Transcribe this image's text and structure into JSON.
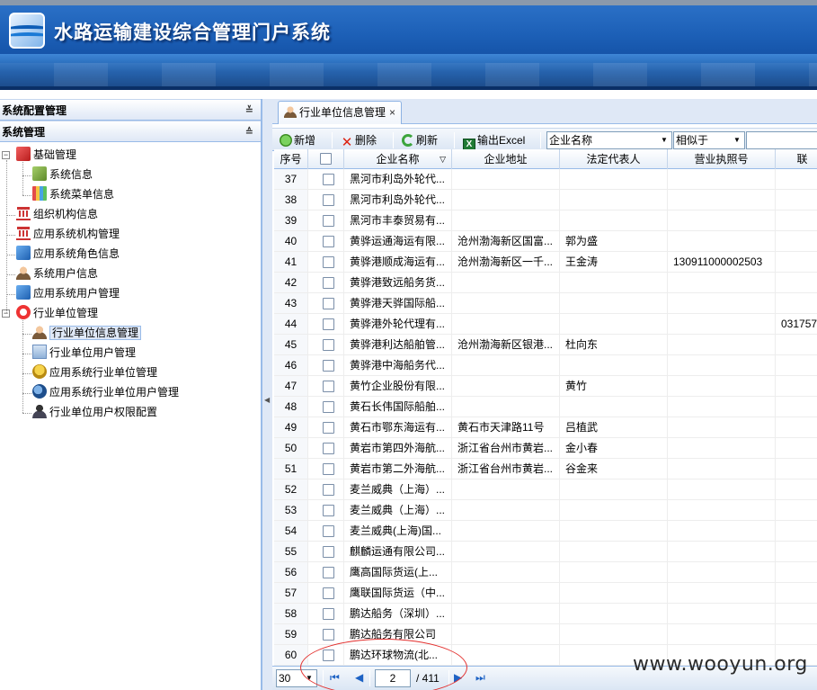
{
  "app": {
    "title": "水路运输建设综合管理门户系统"
  },
  "sidebar": {
    "panel1": {
      "title": "系统配置管理",
      "toggle": "≚"
    },
    "panel2": {
      "title": "系统管理",
      "toggle": "≙"
    },
    "tree": [
      {
        "label": "基础管理",
        "icon": "cube-icon",
        "level": 0,
        "expanded": true
      },
      {
        "label": "系统信息",
        "icon": "module-icon",
        "level": 1
      },
      {
        "label": "系统菜单信息",
        "icon": "menu-icon",
        "level": 1
      },
      {
        "label": "组织机构信息",
        "icon": "org-icon",
        "level": 0
      },
      {
        "label": "应用系统机构管理",
        "icon": "org-icon",
        "level": 0
      },
      {
        "label": "应用系统角色信息",
        "icon": "role-icon",
        "level": 0
      },
      {
        "label": "系统用户信息",
        "icon": "user-icon",
        "level": 0
      },
      {
        "label": "应用系统用户管理",
        "icon": "role-icon",
        "level": 0
      },
      {
        "label": "行业单位管理",
        "icon": "lifebuoy-icon",
        "level": 0,
        "expanded": true
      },
      {
        "label": "行业单位信息管理",
        "icon": "user-icon",
        "level": 1,
        "selected": true
      },
      {
        "label": "行业单位用户管理",
        "icon": "doc-icon",
        "level": 1
      },
      {
        "label": "应用系统行业单位管理",
        "icon": "gold-user-icon",
        "level": 1
      },
      {
        "label": "应用系统行业单位用户管理",
        "icon": "badge-icon",
        "level": 1
      },
      {
        "label": "行业单位用户权限配置",
        "icon": "person-icon",
        "level": 1
      }
    ]
  },
  "tabs": [
    {
      "label": "行业单位信息管理",
      "close": "×"
    }
  ],
  "toolbar": {
    "add": "新增",
    "delete": "删除",
    "refresh": "刷新",
    "export": "输出Excel",
    "field_select": "企业名称",
    "operator_select": "相似于",
    "search_value": ""
  },
  "grid": {
    "columns": [
      "序号",
      "",
      "企业名称",
      "企业地址",
      "法定代表人",
      "营业执照号",
      "联"
    ],
    "rows": [
      [
        "37",
        "黑河市利岛外轮代...",
        "",
        "",
        ""
      ],
      [
        "38",
        "黑河市利岛外轮代...",
        "",
        "",
        ""
      ],
      [
        "39",
        "黑河市丰泰贸易有...",
        "",
        "",
        ""
      ],
      [
        "40",
        "黄骅运通海运有限...",
        "沧州渤海新区国富...",
        "郭为盛",
        ""
      ],
      [
        "41",
        "黄骅港顺成海运有...",
        "沧州渤海新区一千...",
        "王金涛",
        "130911000002503"
      ],
      [
        "42",
        "黄骅港致远船务货...",
        "",
        "",
        ""
      ],
      [
        "43",
        "黄骅港天骅国际船...",
        "",
        "",
        ""
      ],
      [
        "44",
        "黄骅港外轮代理有...",
        "",
        "",
        "",
        "031757"
      ],
      [
        "45",
        "黄骅港利达船舶管...",
        "沧州渤海新区银港...",
        "杜向东",
        ""
      ],
      [
        "46",
        "黄骅港中海船务代...",
        "",
        "",
        ""
      ],
      [
        "47",
        "黄竹企业股份有限...",
        "",
        "黄竹",
        ""
      ],
      [
        "48",
        "黄石长伟国际船舶...",
        "",
        "",
        ""
      ],
      [
        "49",
        "黄石市鄂东海运有...",
        "黄石市天津路11号",
        "吕植武",
        ""
      ],
      [
        "50",
        "黄岩市第四外海航...",
        "浙江省台州市黄岩...",
        "金小春",
        ""
      ],
      [
        "51",
        "黄岩市第二外海航...",
        "浙江省台州市黄岩...",
        "谷金来",
        ""
      ],
      [
        "52",
        "麦兰威典（上海）...",
        "",
        "",
        ""
      ],
      [
        "53",
        "麦兰威典（上海）...",
        "",
        "",
        ""
      ],
      [
        "54",
        "麦兰威典(上海)国...",
        "",
        "",
        ""
      ],
      [
        "55",
        "麒麟运通有限公司...",
        "",
        "",
        ""
      ],
      [
        "56",
        "鹰高国际货运(上...",
        "",
        "",
        ""
      ],
      [
        "57",
        "鹰联国际货运（中...",
        "",
        "",
        ""
      ],
      [
        "58",
        "鹏达船务（深圳）...",
        "",
        "",
        ""
      ],
      [
        "59",
        "鹏达船务有限公司",
        "",
        "",
        ""
      ],
      [
        "60",
        "鹏达环球物流(北...",
        "",
        "",
        ""
      ]
    ]
  },
  "pager": {
    "page_size": "30",
    "current_page": "2",
    "total_pages": "/ 411"
  },
  "watermark": "www.wooyun.org",
  "colors": {
    "header_blue": "#1c5fb6",
    "panel_border": "#99bbe8",
    "annotation_red": "#e3312f"
  }
}
